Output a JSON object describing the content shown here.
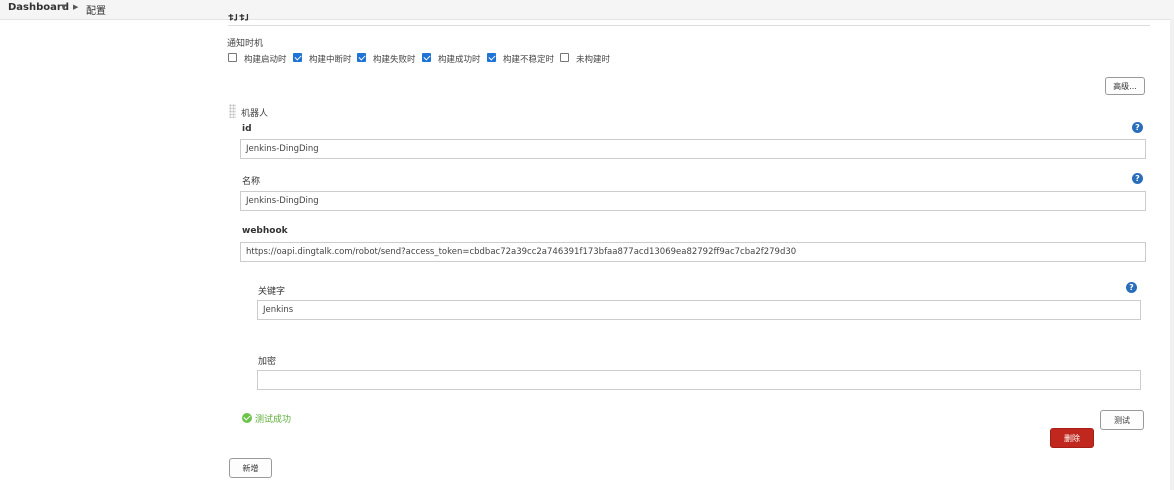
{
  "breadcrumb": {
    "home": "Dashboard",
    "current": "配置"
  },
  "section": {
    "title": "钉钉"
  },
  "notify": {
    "label": "通知时机",
    "options": [
      {
        "label": "构建启动时",
        "checked": false
      },
      {
        "label": "构建中断时",
        "checked": true
      },
      {
        "label": "构建失败时",
        "checked": true
      },
      {
        "label": "构建成功时",
        "checked": true
      },
      {
        "label": "构建不稳定时",
        "checked": true
      },
      {
        "label": "未构建时",
        "checked": false
      }
    ]
  },
  "advanced_button": "高级...",
  "robot": {
    "label": "机器人",
    "id_label": "id",
    "id_value": "Jenkins-DingDing",
    "name_label": "名称",
    "name_value": "Jenkins-DingDing",
    "webhook_label": "webhook",
    "webhook_value": "https://oapi.dingtalk.com/robot/send?access_token=cbdbac72a39cc2a746391f173bfaa877acd13069ea82792ff9ac7cba2f279d30",
    "keyword_label": "关键字",
    "keyword_value": "Jenkins",
    "secret_label": "加密",
    "secret_value": ""
  },
  "test_status": "测试成功",
  "test_button": "测试",
  "delete_button": "删除",
  "add_button": "新增",
  "help_symbol": "?",
  "colors": {
    "accent": "#1f73d6",
    "danger": "#c0281f",
    "success": "#6cc34a",
    "help": "#2a6ebb"
  }
}
